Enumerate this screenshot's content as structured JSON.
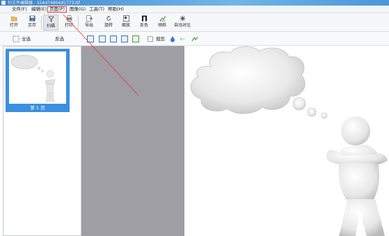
{
  "window": {
    "title": "扫文件编辑器 - 556d74804d1773.tif"
  },
  "menu": {
    "items": [
      {
        "label": "文件(F)"
      },
      {
        "label": "编辑(E)"
      },
      {
        "label": "页面(P)"
      },
      {
        "label": "图像(G)"
      },
      {
        "label": "工具(T)"
      },
      {
        "label": "帮助(H)"
      }
    ]
  },
  "toolbar": {
    "buttons": [
      {
        "label": "打开",
        "icon": "folder-open-icon"
      },
      {
        "label": "另存",
        "icon": "save-icon"
      },
      {
        "label": "扫描",
        "icon": "scan-icon"
      },
      {
        "label": "打印",
        "icon": "print-icon"
      },
      {
        "label": "导出",
        "icon": "export-icon"
      },
      {
        "label": "旋转",
        "icon": "rotate-icon"
      },
      {
        "label": "缩放",
        "icon": "resize-icon"
      },
      {
        "label": "反色",
        "icon": "invert-icon"
      },
      {
        "label": "倾斜",
        "icon": "deskew-icon"
      },
      {
        "label": "自动对比",
        "icon": "auto-contrast-icon"
      }
    ]
  },
  "toolbar2": {
    "select_all": "全选",
    "invert_select": "反选",
    "crop": "裁剪"
  },
  "thumbnails": {
    "items": [
      {
        "label": "第 1 页"
      }
    ]
  },
  "colors": {
    "selection": "#3a8fe0",
    "canvas_gray": "#9e9ea4",
    "annotation_red": "#e0443a"
  }
}
